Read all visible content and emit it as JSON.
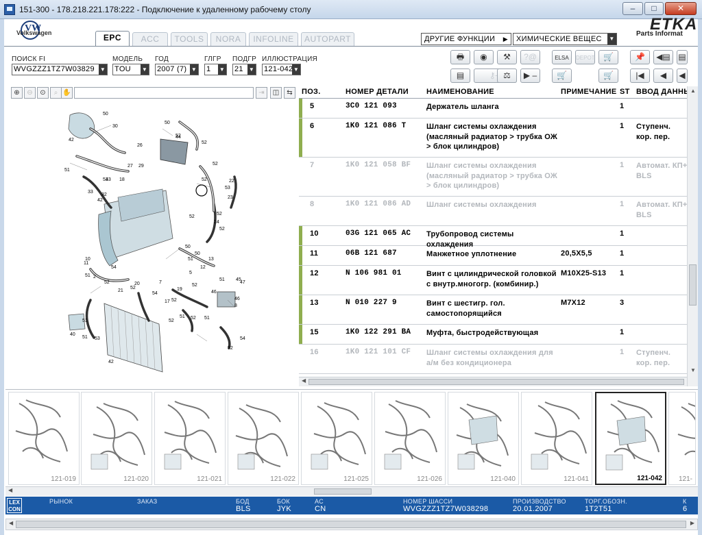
{
  "window": {
    "title": "151-300 - 178.218.221.178:222 - Подключение к удаленному рабочему столу"
  },
  "header": {
    "brand": "Volkswagen",
    "etka_logo": "ETKA",
    "etka_sub": "Parts Informat",
    "tabs": [
      "EPC",
      "ACC",
      "TOOLS",
      "NORA",
      "INFOLINE",
      "AUTOPART"
    ],
    "other_functions": "ДРУГИЕ ФУНКЦИИ",
    "chemicals": "ХИМИЧЕСКИЕ ВЕЩЕС"
  },
  "selectors": {
    "search_fi": {
      "label": "ПОИСК FI",
      "value": "WVGZZZ1TZ7W03829"
    },
    "model": {
      "label": "МОДЕЛЬ",
      "value": "TOU"
    },
    "year": {
      "label": "ГОД",
      "value": "2007 (7)"
    },
    "mg": {
      "label": "ГЛГР",
      "value": "1"
    },
    "sg": {
      "label": "ПОДГР",
      "value": "21"
    },
    "illustration": {
      "label": "ИЛЛЮСТРАЦИЯ",
      "value": "121-042"
    }
  },
  "table": {
    "headers": {
      "pos": "ПОЗ.",
      "part": "НОМЕР ДЕТАЛИ",
      "name": "НАИМЕНОВАНИЕ",
      "note": "ПРИМЕЧАНИЕ",
      "st": "ST",
      "entry": "ВВОД ДАННЫ"
    },
    "rows": [
      {
        "pos": "5",
        "part": "3C0  121  093",
        "name": "Держатель шланга",
        "note": "",
        "st": "1",
        "entry": "",
        "dim": false
      },
      {
        "pos": "6",
        "part": "1K0  121  086  T",
        "name": "Шланг системы охлаждения (масляный радиатор > трубка ОЖ > блок цилиндров)",
        "note": "",
        "st": "1",
        "entry": "Ступенч. кор. пер.",
        "dim": false
      },
      {
        "pos": "7",
        "part": "1K0  121  058  BF",
        "name": "Шланг системы охлаждения (масляный радиатор > трубка ОЖ > блок цилиндров)",
        "note": "",
        "st": "1",
        "entry": "Автомат. КП+ BLS",
        "dim": true
      },
      {
        "pos": "8",
        "part": "1K0  121  086  AD",
        "name": "Шланг системы охлаждения",
        "note": "",
        "st": "1",
        "entry": "Автомат. КП+ BLS",
        "dim": true
      },
      {
        "pos": "10",
        "part": "03G  121  065  AC",
        "name": "Трубопровод системы охлаждения",
        "note": "",
        "st": "1",
        "entry": "",
        "dim": false
      },
      {
        "pos": "11",
        "part": "06B  121  687",
        "name": "Манжетное уплотнение",
        "note": "20,5X5,5",
        "st": "1",
        "entry": "",
        "dim": false
      },
      {
        "pos": "12",
        "part": "N    106  981  01",
        "name": "Винт с цилиндрической головкой с внутр.многогр. (комбинир.)",
        "note": "M10X25-S13",
        "st": "1",
        "entry": "",
        "dim": false
      },
      {
        "pos": "13",
        "part": "N    010  227  9",
        "name": "Винт с шестигр. гол. самостопорящийся",
        "note": "M7X12",
        "st": "3",
        "entry": "",
        "dim": false
      },
      {
        "pos": "15",
        "part": "1K0  122  291  BA",
        "name": "Муфта, быстродействующая",
        "note": "",
        "st": "1",
        "entry": "",
        "dim": false
      },
      {
        "pos": "16",
        "part": "1K0  121  101  CF",
        "name": "Шланг системы охлаждения для а/м без кондиционера",
        "note": "",
        "st": "1",
        "entry": "Ступенч. кор. пер.",
        "dim": true
      }
    ]
  },
  "diagram": {
    "labels": [
      "50",
      "30",
      "42",
      "50",
      "52",
      "44",
      "52",
      "26",
      "27",
      "29",
      "53",
      "18",
      "52",
      "51",
      "42",
      "43",
      "33",
      "32",
      "22",
      "52",
      "53",
      "23",
      "52",
      "52",
      "52",
      "24",
      "50",
      "50",
      "51",
      "10",
      "11",
      "54",
      "51",
      "2",
      "52",
      "20",
      "7",
      "52",
      "54",
      "52",
      "52",
      "51",
      "45",
      "47",
      "17",
      "5",
      "13",
      "12",
      "46",
      "19",
      "52",
      "51",
      "46",
      "51",
      "40",
      "8",
      "51",
      "53",
      "54",
      "52",
      "42",
      "52",
      "51",
      "21"
    ]
  },
  "thumbnails": [
    "121-019",
    "121-020",
    "121-021",
    "121-022",
    "121-025",
    "121-026",
    "121-040",
    "121-041",
    "121-042",
    "121-"
  ],
  "status": {
    "lexcon": "LEX CON",
    "market_label": "РЫНОК",
    "order_label": "ЗАКАЗ",
    "engine_code_label": "БОД",
    "engine_code": "BLS",
    "gearbox_label": "БОК",
    "gearbox": "JYK",
    "ac_label": "АС",
    "ac": "CN",
    "vin_label": "НОМЕР ШАССИ",
    "vin": "WVGZZZ1TZ7W038298",
    "production_label": "ПРОИЗВОДСТВО",
    "production": "20.01.2007",
    "trade_label": "ТОРГ.ОБОЗН.",
    "trade": "1T2T51",
    "extra_label": "К",
    "extra": "6"
  },
  "icons": {
    "colors": {
      "status_bg": "#1b5aa6",
      "valid_bar": "#8fae4f"
    }
  }
}
